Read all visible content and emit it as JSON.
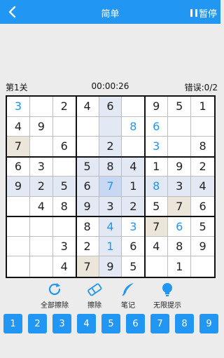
{
  "header": {
    "title": "简单",
    "pause_label": "暂停"
  },
  "status": {
    "level": "第1关",
    "timer": "00:00:26",
    "errors": "错误:0/2"
  },
  "board": {
    "cells": [
      {
        "v": "3",
        "t": "user"
      },
      {
        "v": "",
        "t": "empty"
      },
      {
        "v": "2",
        "t": "given"
      },
      {
        "v": "4",
        "t": "given"
      },
      {
        "v": "6",
        "t": "given",
        "h": "hl"
      },
      {
        "v": "",
        "t": "empty"
      },
      {
        "v": "9",
        "t": "given"
      },
      {
        "v": "5",
        "t": "given"
      },
      {
        "v": "1",
        "t": "given"
      },
      {
        "v": "4",
        "t": "given"
      },
      {
        "v": "9",
        "t": "given"
      },
      {
        "v": "",
        "t": "empty"
      },
      {
        "v": "",
        "t": "empty"
      },
      {
        "v": "",
        "t": "empty",
        "h": "hl"
      },
      {
        "v": "8",
        "t": "user"
      },
      {
        "v": "6",
        "t": "user"
      },
      {
        "v": "",
        "t": "empty"
      },
      {
        "v": "",
        "t": "empty"
      },
      {
        "v": "7",
        "t": "given",
        "h": "tan"
      },
      {
        "v": "",
        "t": "empty"
      },
      {
        "v": "6",
        "t": "given"
      },
      {
        "v": "",
        "t": "empty"
      },
      {
        "v": "2",
        "t": "given",
        "h": "hl"
      },
      {
        "v": "",
        "t": "empty"
      },
      {
        "v": "3",
        "t": "user"
      },
      {
        "v": "",
        "t": "empty"
      },
      {
        "v": "8",
        "t": "given"
      },
      {
        "v": "6",
        "t": "given"
      },
      {
        "v": "3",
        "t": "given"
      },
      {
        "v": "",
        "t": "empty"
      },
      {
        "v": "5",
        "t": "given",
        "h": "hl"
      },
      {
        "v": "8",
        "t": "given",
        "h": "hl"
      },
      {
        "v": "4",
        "t": "given",
        "h": "hl"
      },
      {
        "v": "1",
        "t": "given"
      },
      {
        "v": "9",
        "t": "given"
      },
      {
        "v": "2",
        "t": "given"
      },
      {
        "v": "9",
        "t": "given",
        "h": "hl"
      },
      {
        "v": "2",
        "t": "given",
        "h": "hl"
      },
      {
        "v": "5",
        "t": "given",
        "h": "hl"
      },
      {
        "v": "6",
        "t": "given",
        "h": "hl"
      },
      {
        "v": "7",
        "t": "user",
        "h": "sel"
      },
      {
        "v": "1",
        "t": "given",
        "h": "hl"
      },
      {
        "v": "8",
        "t": "user",
        "h": "hl"
      },
      {
        "v": "3",
        "t": "given",
        "h": "hl"
      },
      {
        "v": "4",
        "t": "given",
        "h": "hl"
      },
      {
        "v": "",
        "t": "empty"
      },
      {
        "v": "4",
        "t": "given"
      },
      {
        "v": "8",
        "t": "given"
      },
      {
        "v": "9",
        "t": "given",
        "h": "hl"
      },
      {
        "v": "3",
        "t": "given",
        "h": "hl"
      },
      {
        "v": "2",
        "t": "given",
        "h": "hl"
      },
      {
        "v": "5",
        "t": "given"
      },
      {
        "v": "7",
        "t": "given",
        "h": "tan"
      },
      {
        "v": "6",
        "t": "given"
      },
      {
        "v": "",
        "t": "empty"
      },
      {
        "v": "",
        "t": "empty"
      },
      {
        "v": "",
        "t": "empty"
      },
      {
        "v": "8",
        "t": "given"
      },
      {
        "v": "4",
        "t": "user",
        "h": "hl"
      },
      {
        "v": "3",
        "t": "user"
      },
      {
        "v": "7",
        "t": "given",
        "h": "tan"
      },
      {
        "v": "6",
        "t": "user"
      },
      {
        "v": "5",
        "t": "given"
      },
      {
        "v": "",
        "t": "empty"
      },
      {
        "v": "",
        "t": "empty"
      },
      {
        "v": "3",
        "t": "given"
      },
      {
        "v": "2",
        "t": "given"
      },
      {
        "v": "1",
        "t": "user",
        "h": "hl"
      },
      {
        "v": "6",
        "t": "given"
      },
      {
        "v": "4",
        "t": "given"
      },
      {
        "v": "8",
        "t": "given"
      },
      {
        "v": "9",
        "t": "given"
      },
      {
        "v": "",
        "t": "empty"
      },
      {
        "v": "",
        "t": "empty"
      },
      {
        "v": "4",
        "t": "given"
      },
      {
        "v": "7",
        "t": "given",
        "h": "tan"
      },
      {
        "v": "9",
        "t": "given",
        "h": "hl"
      },
      {
        "v": "5",
        "t": "given"
      },
      {
        "v": "",
        "t": "empty"
      },
      {
        "v": "1",
        "t": "given"
      },
      {
        "v": "",
        "t": "empty"
      }
    ]
  },
  "tools": [
    {
      "label": "全部擦除",
      "icon": "refresh-icon"
    },
    {
      "label": "擦除",
      "icon": "eraser-icon"
    },
    {
      "label": "笔记",
      "icon": "feather-icon"
    },
    {
      "label": "无限提示",
      "icon": "lightbulb-icon"
    }
  ],
  "keypad": [
    "1",
    "2",
    "3",
    "4",
    "5",
    "6",
    "7",
    "8",
    "9"
  ],
  "colors": {
    "accent": "#2196f3",
    "highlight": "#e2e8f4",
    "selected": "#c8d8f2",
    "tan": "#ece5da"
  }
}
